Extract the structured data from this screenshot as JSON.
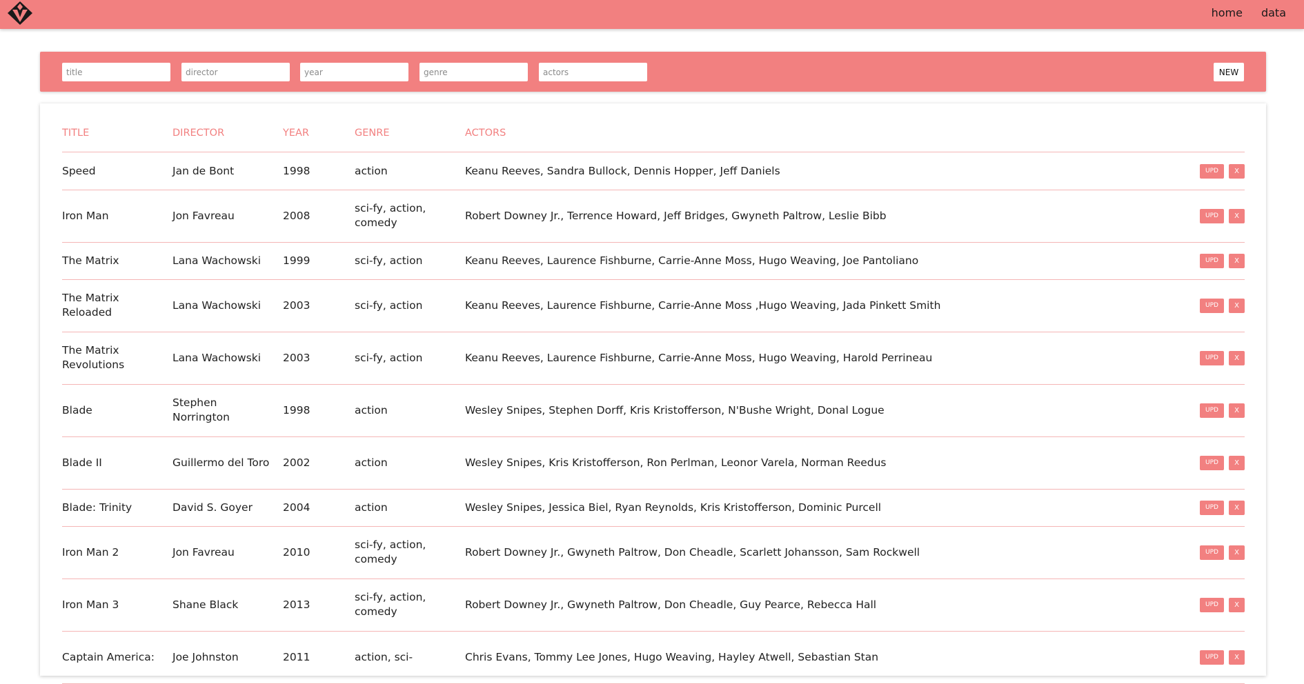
{
  "nav": {
    "home_label": "home",
    "data_label": "data"
  },
  "logo": {
    "icon": "diamond-v-logo"
  },
  "filters": {
    "title_placeholder": "title",
    "director_placeholder": "director",
    "year_placeholder": "year",
    "genre_placeholder": "genre",
    "actors_placeholder": "actors",
    "new_label": "NEW"
  },
  "table": {
    "headers": {
      "title": "TITLE",
      "director": "DIRECTOR",
      "year": "YEAR",
      "genre": "GENRE",
      "actors": "ACTORS"
    },
    "upd_label": "UPD",
    "delete_label": "X",
    "rows": [
      {
        "title": "Speed",
        "director": "Jan de Bont",
        "year": "1998",
        "genre": "action",
        "actors": "Keanu Reeves, Sandra Bullock, Dennis Hopper, Jeff Daniels"
      },
      {
        "title": "Iron Man",
        "director": "Jon Favreau",
        "year": "2008",
        "genre": "sci-fy, action, comedy",
        "actors": "Robert Downey Jr., Terrence Howard, Jeff Bridges, Gwyneth Paltrow, Leslie Bibb"
      },
      {
        "title": "The Matrix",
        "director": "Lana Wachowski",
        "year": "1999",
        "genre": "sci-fy, action",
        "actors": "Keanu Reeves, Laurence Fishburne, Carrie-Anne Moss, Hugo Weaving, Joe Pantoliano"
      },
      {
        "title": "The Matrix Reloaded",
        "director": "Lana Wachowski",
        "year": "2003",
        "genre": "sci-fy, action",
        "actors": "Keanu Reeves, Laurence Fishburne, Carrie-Anne Moss ,Hugo Weaving, Jada Pinkett Smith"
      },
      {
        "title": "The Matrix Revolutions",
        "director": "Lana Wachowski",
        "year": "2003",
        "genre": "sci-fy, action",
        "actors": "Keanu Reeves, Laurence Fishburne, Carrie-Anne Moss, Hugo Weaving, Harold Perrineau"
      },
      {
        "title": "Blade",
        "director": "Stephen Norrington",
        "year": "1998",
        "genre": "action",
        "actors": "Wesley Snipes, Stephen Dorff, Kris Kristofferson, N'Bushe Wright, Donal Logue"
      },
      {
        "title": "Blade II",
        "director": "Guillermo del Toro",
        "year": "2002",
        "genre": "action",
        "actors": "Wesley Snipes, Kris Kristofferson, Ron Perlman, Leonor Varela, Norman Reedus"
      },
      {
        "title": "Blade: Trinity",
        "director": "David S. Goyer",
        "year": "2004",
        "genre": "action",
        "actors": "Wesley Snipes, Jessica Biel, Ryan Reynolds, Kris Kristofferson, Dominic Purcell"
      },
      {
        "title": "Iron Man 2",
        "director": "Jon Favreau",
        "year": "2010",
        "genre": "sci-fy, action, comedy",
        "actors": "Robert Downey Jr., Gwyneth Paltrow, Don Cheadle, Scarlett Johansson, Sam Rockwell"
      },
      {
        "title": "Iron Man 3",
        "director": "Shane Black",
        "year": "2013",
        "genre": "sci-fy, action, comedy",
        "actors": "Robert Downey Jr., Gwyneth Paltrow, Don Cheadle, Guy Pearce, Rebecca Hall"
      },
      {
        "title": "Captain America:",
        "director": "Joe Johnston",
        "year": "2011",
        "genre": "action, sci-",
        "actors": "Chris Evans, Tommy Lee Jones, Hugo Weaving, Hayley Atwell, Sebastian Stan"
      }
    ]
  },
  "colors": {
    "accent": "#f28080",
    "divider": "#f5b5b5"
  }
}
